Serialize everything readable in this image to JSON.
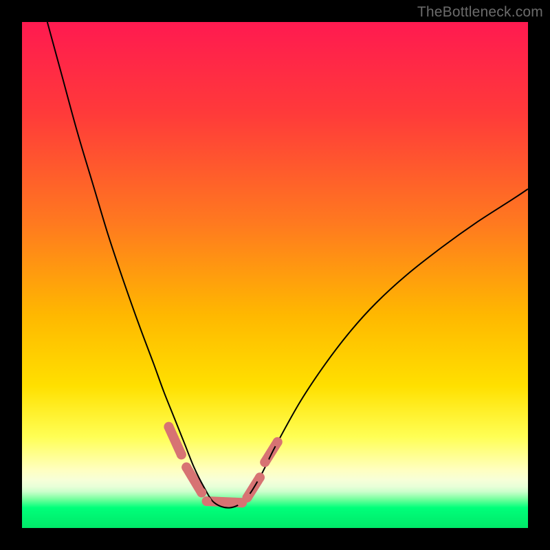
{
  "watermark": "TheBottleneck.com",
  "chart_data": {
    "type": "line",
    "title": "",
    "xlabel": "",
    "ylabel": "",
    "xlim": [
      0,
      100
    ],
    "ylim": [
      0,
      100
    ],
    "gradient_stops": [
      {
        "offset": 0.0,
        "color": "#ff1a50"
      },
      {
        "offset": 0.18,
        "color": "#ff3a3a"
      },
      {
        "offset": 0.4,
        "color": "#ff7a1f"
      },
      {
        "offset": 0.58,
        "color": "#ffb800"
      },
      {
        "offset": 0.72,
        "color": "#ffe000"
      },
      {
        "offset": 0.82,
        "color": "#ffff55"
      },
      {
        "offset": 0.885,
        "color": "#ffffc0"
      },
      {
        "offset": 0.905,
        "color": "#f7ffd8"
      },
      {
        "offset": 0.918,
        "color": "#e8ffd8"
      },
      {
        "offset": 0.928,
        "color": "#ccffcc"
      },
      {
        "offset": 0.935,
        "color": "#a6ffb8"
      },
      {
        "offset": 0.943,
        "color": "#75ff9e"
      },
      {
        "offset": 0.96,
        "color": "#00ff7a"
      },
      {
        "offset": 1.0,
        "color": "#00e868"
      }
    ],
    "series": [
      {
        "name": "bottleneck-curve",
        "color": "#000000",
        "width": 2,
        "x": [
          5.0,
          8.0,
          11.0,
          14.0,
          17.0,
          20.0,
          23.0,
          26.0,
          28.0,
          30.0,
          32.0,
          34.0,
          36.0,
          38.0,
          41.0,
          44.0,
          47.0,
          50.0,
          55.0,
          60.0,
          65.0,
          70.0,
          76.0,
          83.0,
          90.0,
          97.0,
          100.0
        ],
        "y": [
          100.0,
          89.0,
          78.0,
          68.0,
          58.0,
          49.0,
          40.5,
          32.5,
          27.0,
          22.0,
          17.0,
          12.0,
          8.0,
          5.0,
          4.0,
          5.5,
          10.0,
          16.0,
          25.0,
          32.5,
          39.0,
          44.5,
          50.0,
          55.5,
          60.5,
          65.0,
          67.0
        ]
      }
    ],
    "highlight_segments": {
      "color": "#d77373",
      "width": 14,
      "segments": [
        {
          "x": [
            29.0,
            31.5
          ],
          "y": [
            20.0,
            14.5
          ]
        },
        {
          "x": [
            32.5,
            35.5
          ],
          "y": [
            12.0,
            7.0
          ]
        },
        {
          "x": [
            36.5,
            43.5
          ],
          "y": [
            5.3,
            5.0
          ]
        },
        {
          "x": [
            44.5,
            47.0
          ],
          "y": [
            6.0,
            10.0
          ]
        },
        {
          "x": [
            48.0,
            50.5
          ],
          "y": [
            13.0,
            17.0
          ]
        }
      ]
    },
    "highlight_dots": {
      "color": "#d77373",
      "radius": 7,
      "points": [
        {
          "x": 29.0,
          "y": 20.0
        },
        {
          "x": 31.5,
          "y": 14.5
        },
        {
          "x": 32.5,
          "y": 12.0
        },
        {
          "x": 35.5,
          "y": 7.0
        },
        {
          "x": 36.5,
          "y": 5.3
        },
        {
          "x": 43.5,
          "y": 5.0
        },
        {
          "x": 44.5,
          "y": 6.0
        },
        {
          "x": 47.0,
          "y": 10.0
        },
        {
          "x": 48.0,
          "y": 13.0
        },
        {
          "x": 50.5,
          "y": 17.0
        }
      ]
    }
  }
}
